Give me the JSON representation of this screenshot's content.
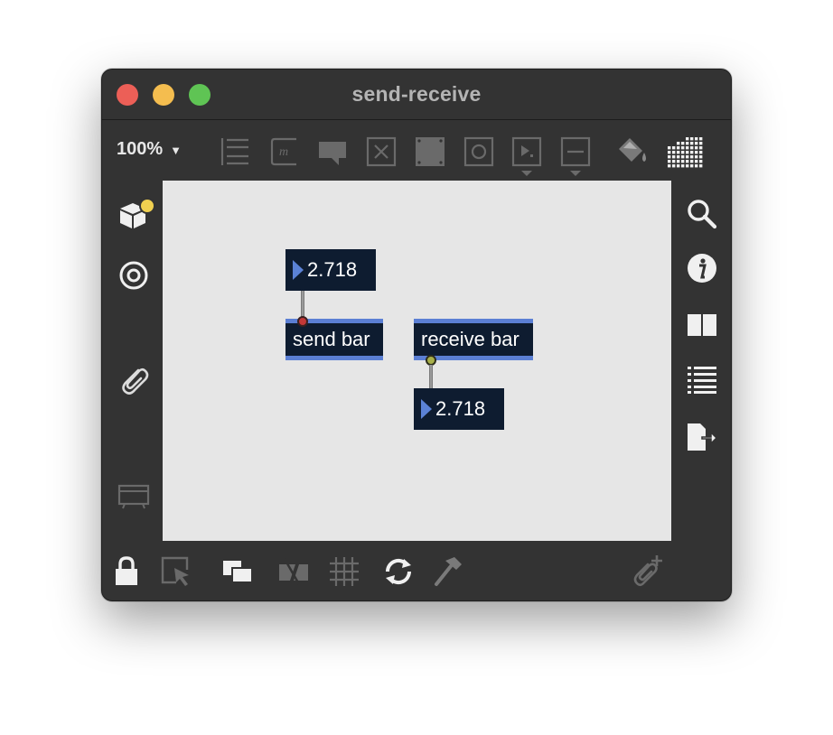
{
  "window": {
    "title": "send-receive",
    "traffic_lights": {
      "close": "#ec5f57",
      "minimize": "#f4bd4f",
      "maximize": "#5fc454"
    }
  },
  "toolbar": {
    "zoom": "100%",
    "zoom_caret": "▼",
    "icons": [
      "presentation-icon",
      "comment-m-icon",
      "speech-bubble-icon",
      "toggle-x-icon",
      "panel-icon",
      "circle-button-icon",
      "play-menu-icon",
      "slider-menu-icon",
      "paint-bucket-icon",
      "grid-palette-icon"
    ]
  },
  "left_sidebar": {
    "icons": [
      "package-icon",
      "target-icon",
      "paperclip-icon",
      "presentation-frame-icon"
    ]
  },
  "right_sidebar": {
    "icons": [
      "search-icon",
      "info-icon",
      "book-icon",
      "list-icon",
      "export-icon"
    ]
  },
  "bottom_toolbar": {
    "icons": [
      "lock-icon",
      "select-icon",
      "overlap-windows-icon",
      "hide-icon",
      "grid-icon",
      "refresh-icon",
      "hammer-icon",
      "add-clip-icon"
    ]
  },
  "patch": {
    "send_number": "2.718",
    "send_object": "send bar",
    "receive_object": "receive bar",
    "receive_number": "2.718"
  },
  "colors": {
    "window_bg": "#333333",
    "canvas_bg": "#e6e6e6",
    "object_bg": "#0e1c30",
    "accent": "#5b7fd4",
    "notification_dot": "#f0d050"
  }
}
